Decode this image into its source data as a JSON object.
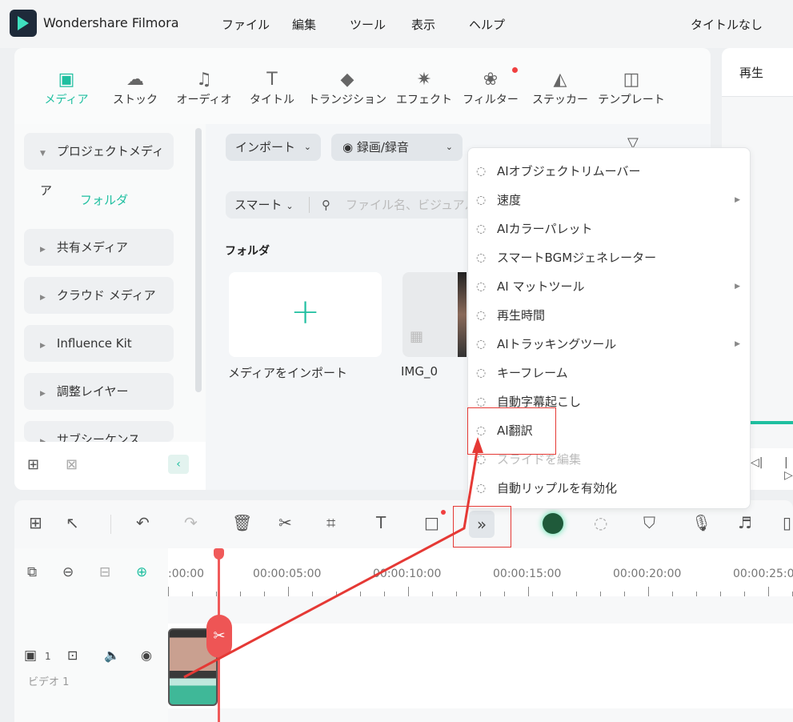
{
  "app": {
    "title": "Wondershare Filmora",
    "project": "タイトルなし"
  },
  "menubar": [
    "ファイル",
    "編集",
    "ツール",
    "表示",
    "ヘルプ"
  ],
  "media_tabs": [
    {
      "label": "メディア",
      "icon": "media-icon",
      "active": true
    },
    {
      "label": "ストック",
      "icon": "cloud-folder-icon"
    },
    {
      "label": "オーディオ",
      "icon": "music-note-icon"
    },
    {
      "label": "タイトル",
      "icon": "title-t-icon"
    },
    {
      "label": "トランジション",
      "icon": "transition-icon"
    },
    {
      "label": "エフェクト",
      "icon": "effect-sparkle-icon"
    },
    {
      "label": "フィルター",
      "icon": "filter-icon",
      "badge": true
    },
    {
      "label": "ステッカー",
      "icon": "sticker-icon"
    },
    {
      "label": "テンプレート",
      "icon": "template-icon"
    }
  ],
  "sidebar": {
    "items": [
      "プロジェクトメディア",
      "フォルダ",
      "共有メディア",
      "クラウド メディア",
      "Influence Kit",
      "調整レイヤー",
      "サブシーケンス"
    ]
  },
  "media": {
    "import_label": "インポート",
    "record_label": "録画/録音",
    "smart_label": "スマート",
    "search_placeholder": "ファイル名、ビジュアル",
    "folder_heading": "フォルダ",
    "import_card_label": "メディアをインポート",
    "clip_name": "IMG_0"
  },
  "player": {
    "tab": "再生"
  },
  "context_menu": [
    {
      "label": "AIオブジェクトリムーバー",
      "icon": "object-remover-icon"
    },
    {
      "label": "速度",
      "icon": "speed-icon",
      "submenu": true
    },
    {
      "label": "AIカラーパレット",
      "icon": "palette-icon"
    },
    {
      "label": "スマートBGMジェネレーター",
      "icon": "bgm-icon"
    },
    {
      "label": "AI マットツール",
      "icon": "matte-icon",
      "submenu": true
    },
    {
      "label": "再生時間",
      "icon": "timer-icon"
    },
    {
      "label": "AIトラッキングツール",
      "icon": "tracking-icon",
      "submenu": true
    },
    {
      "label": "キーフレーム",
      "icon": "keyframe-icon"
    },
    {
      "label": "自動字幕起こし",
      "icon": "subtitle-icon"
    },
    {
      "label": "AI翻訳",
      "icon": "translate-icon",
      "highlighted": true
    },
    {
      "label": "スライドを編集",
      "icon": "slide-icon",
      "disabled": true
    },
    {
      "label": "自動リップルを有効化",
      "icon": "ripple-icon"
    }
  ],
  "timeline": {
    "ruler": [
      ":00:00",
      "00:00:05:00",
      "00:00:10:00",
      "00:00:15:00",
      "00:00:20:00",
      "00:00:25:00"
    ],
    "track_label": "ビデオ 1",
    "track_number": "1"
  },
  "colors": {
    "accent": "#1fbfa0",
    "annotation": "#e53935"
  }
}
